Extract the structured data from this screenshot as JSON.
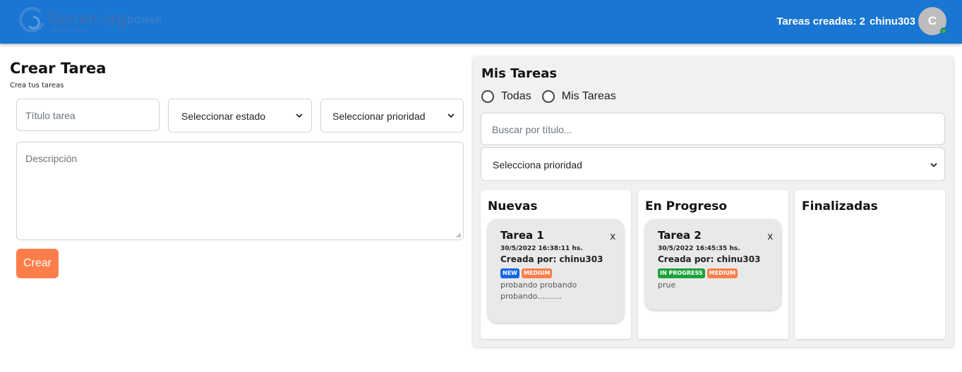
{
  "header": {
    "logo_text": "Scrum.org",
    "logo_tagline": "The Home of Scrum",
    "donate_label": "DONAR",
    "counter_label": "Tareas creadas: 2",
    "username": "chinu303",
    "avatar_initial": "C",
    "colors": {
      "bar": "#1976d2",
      "online": "#44b700"
    }
  },
  "create": {
    "title": "Crear Tarea",
    "subtitle": "Crea tus tareas",
    "title_placeholder": "Título tarea",
    "status_select": "Seleccionar estado",
    "priority_select": "Seleccionar prioridad",
    "description_placeholder": "Descripción",
    "create_button": "Crear",
    "button_color": "#fd7e4a"
  },
  "tasks": {
    "title": "Mis Tareas",
    "filters": [
      "Todas",
      "Mis Tareas"
    ],
    "search_placeholder": "Buscar por título...",
    "priority_select": "Selecciona prioridad",
    "columns": [
      {
        "title": "Nuevas",
        "cards": [
          {
            "title": "Tarea 1",
            "close": "x",
            "date": "30/5/2022 16:38:11 hs.",
            "author": "Creada por: chinu303",
            "status_badge": "NEW",
            "priority_badge": "MEDIUM",
            "description": "probando probando probando..........",
            "status_color": "#1565e6",
            "priority_color": "#fd7e4a"
          }
        ]
      },
      {
        "title": "En Progreso",
        "cards": [
          {
            "title": "Tarea 2",
            "close": "x",
            "date": "30/5/2022 16:45:35 hs.",
            "author": "Creada por: chinu303",
            "status_badge": "IN PROGRESS",
            "priority_badge": "MEDIUM",
            "description": "prue",
            "status_color": "#1aa33b",
            "priority_color": "#fd7e4a"
          }
        ]
      },
      {
        "title": "Finalizadas",
        "cards": []
      }
    ]
  }
}
